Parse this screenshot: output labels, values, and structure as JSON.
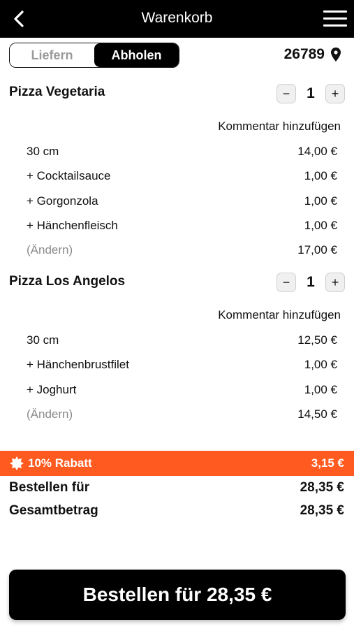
{
  "header": {
    "title": "Warenkorb",
    "back_icon": "chevron-left-icon",
    "menu_icon": "hamburger-menu-icon"
  },
  "delivery_toggle": {
    "options": [
      "Liefern",
      "Abholen"
    ],
    "selected": "Abholen"
  },
  "location": {
    "zip": "26789",
    "icon": "location-pin-icon"
  },
  "items": [
    {
      "name": "Pizza Vegetaria",
      "quantity": "1",
      "comment_label": "Kommentar hinzufügen",
      "lines": [
        {
          "label": "30 cm",
          "price": "14,00 €"
        },
        {
          "label": "+ Cocktailsauce",
          "price": "1,00 €"
        },
        {
          "label": "+ Gorgonzola",
          "price": "1,00 €"
        },
        {
          "label": "+ Hänchenfleisch",
          "price": "1,00 €"
        }
      ],
      "edit_label": "(Ändern)",
      "total": "17,00 €"
    },
    {
      "name": "Pizza Los Angelos",
      "quantity": "1",
      "comment_label": "Kommentar hinzufügen",
      "lines": [
        {
          "label": "30 cm",
          "price": "12,50 €"
        },
        {
          "label": "+ Hänchenbrustfilet",
          "price": "1,00 €"
        },
        {
          "label": "+ Joghurt",
          "price": "1,00 €"
        }
      ],
      "edit_label": "(Ändern)",
      "total": "14,50 €"
    }
  ],
  "discount": {
    "label": "10% Rabatt",
    "amount": "3,15 €",
    "color": "#ff5a1f"
  },
  "summary": {
    "order_label": "Bestellen für",
    "order_value": "28,35 €",
    "total_label": "Gesamtbetrag",
    "total_value": "28,35 €"
  },
  "cta": {
    "label": "Bestellen für 28,35 €"
  },
  "colors": {
    "bar": "#000000",
    "accent": "#ff5a1f"
  }
}
